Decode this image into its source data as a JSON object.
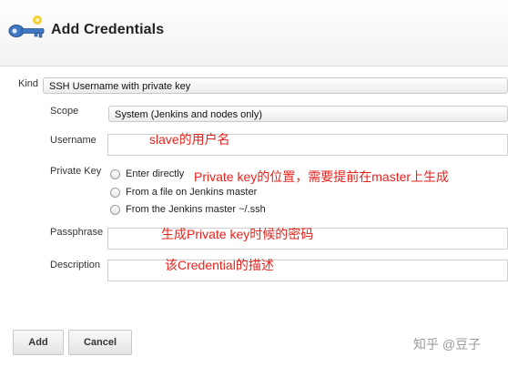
{
  "header": {
    "title": "Add Credentials",
    "icon": "key-icon"
  },
  "form": {
    "kind": {
      "label": "Kind",
      "value": "SSH Username with private key"
    },
    "scope": {
      "label": "Scope",
      "value": "System (Jenkins and nodes only)"
    },
    "username": {
      "label": "Username",
      "value": "",
      "annotation": "slave的用户名"
    },
    "private_key": {
      "label": "Private Key",
      "options": [
        "Enter directly",
        "From a file on Jenkins master",
        "From the Jenkins master ~/.ssh"
      ],
      "annotation": "Private key的位置，需要提前在master上生成"
    },
    "passphrase": {
      "label": "Passphrase",
      "value": "",
      "annotation": "生成Private key时候的密码"
    },
    "description": {
      "label": "Description",
      "value": "",
      "annotation": "该Credential的描述"
    }
  },
  "buttons": {
    "add_label": "Add",
    "cancel_label": "Cancel"
  },
  "watermark": "知乎 @豆子",
  "colors": {
    "annotation": "#e8231d",
    "key_blue": "#3f78c4",
    "key_yellow": "#f5d13a"
  }
}
